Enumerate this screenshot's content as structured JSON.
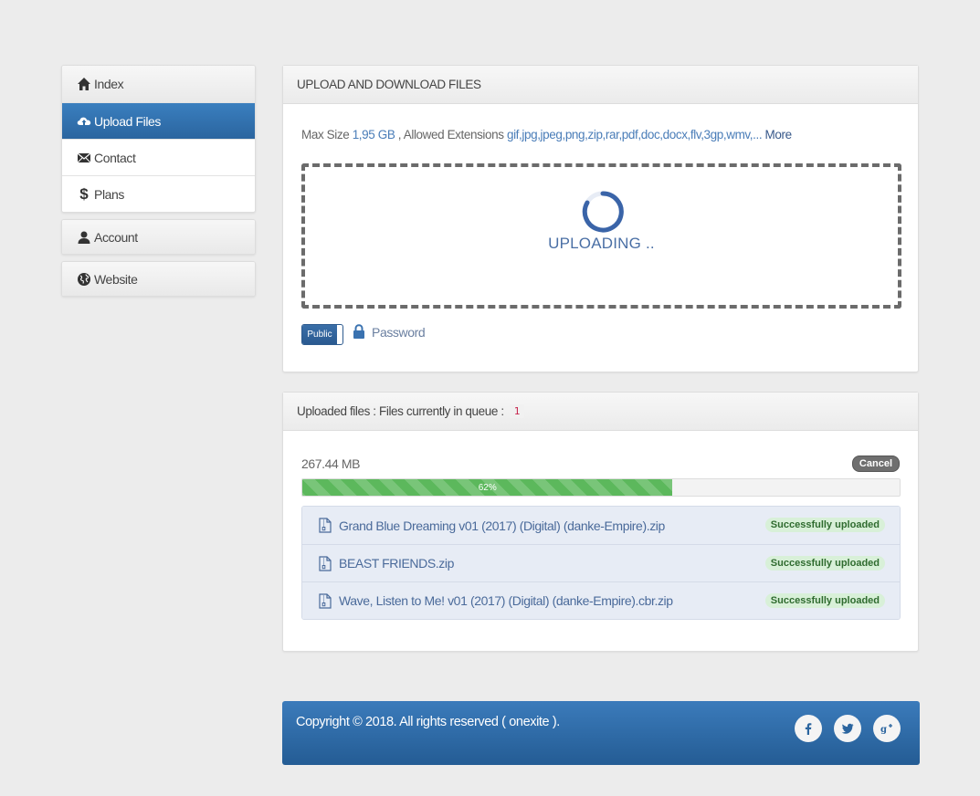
{
  "sidebar": {
    "main_items": [
      {
        "label": "Index",
        "icon": "home-icon"
      },
      {
        "label": "Upload Files",
        "icon": "cloud-upload-icon"
      },
      {
        "label": "Contact",
        "icon": "envelope-icon"
      },
      {
        "label": "Plans",
        "icon": "dollar-icon"
      }
    ],
    "account_label": "Account",
    "website_label": "Website"
  },
  "upload_panel": {
    "title": "UPLOAD AND DOWNLOAD FILES",
    "max_size_label": "Max Size",
    "max_size_value": "1,95 GB",
    "allowed_label": ", Allowed Extensions",
    "allowed_value": "gif,jpg,jpeg,png,zip,rar,pdf,doc,docx,flv,3gp,wmv,...",
    "more_label": "More",
    "status_text": "UPLOADING ..",
    "toggle_label": "Public",
    "password_label": "Password"
  },
  "queue_panel": {
    "title": "Uploaded files : Files currently in queue :",
    "queue_count": "1",
    "size": "267.44 MB",
    "cancel_label": "Cancel",
    "progress_percent": 62,
    "progress_label": "62%",
    "files": [
      {
        "name": "Grand Blue Dreaming v01 (2017) (Digital) (danke-Empire).zip",
        "status": "Successfully uploaded"
      },
      {
        "name": "BEAST FRIENDS.zip",
        "status": "Successfully uploaded"
      },
      {
        "name": "Wave, Listen to Me! v01 (2017) (Digital) (danke-Empire).cbr.zip",
        "status": "Successfully uploaded"
      }
    ]
  },
  "footer": {
    "copyright": "Copyright © 2018. All rights reserved ( onexite ).",
    "social": [
      "facebook-icon",
      "twitter-icon",
      "google-plus-icon"
    ]
  },
  "colors": {
    "accent": "#2b659f",
    "progress": "#5cb85c",
    "background": "#ececec"
  }
}
